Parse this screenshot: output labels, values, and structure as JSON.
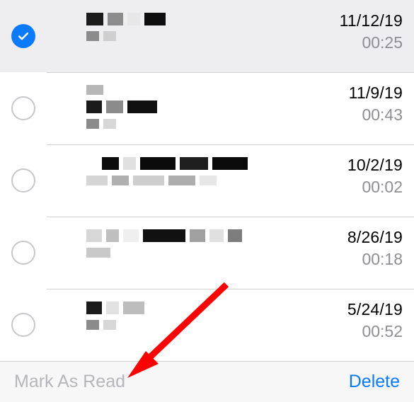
{
  "toolbar": {
    "markRead": "Mark As Read",
    "delete": "Delete"
  },
  "colors": {
    "accent": "#0a7aff",
    "arrow": "#ff0000"
  },
  "items": [
    {
      "selected": true,
      "date": "11/12/19",
      "duration": "00:25"
    },
    {
      "selected": false,
      "date": "11/9/19",
      "duration": "00:43"
    },
    {
      "selected": false,
      "date": "10/2/19",
      "duration": "00:02"
    },
    {
      "selected": false,
      "date": "8/26/19",
      "duration": "00:18"
    },
    {
      "selected": false,
      "date": "5/24/19",
      "duration": "00:52"
    }
  ]
}
